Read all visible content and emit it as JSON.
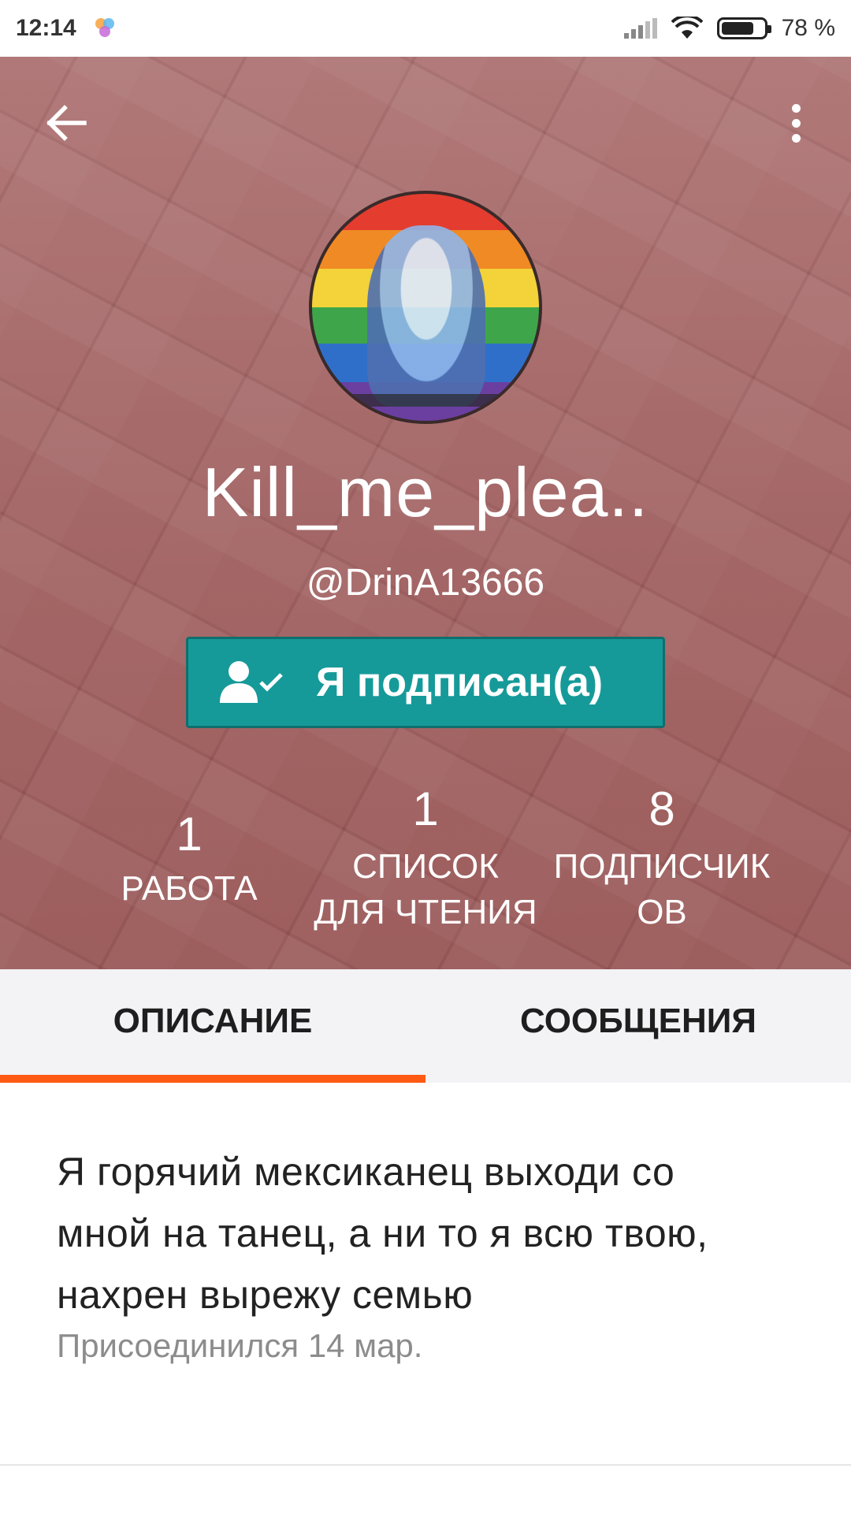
{
  "status_bar": {
    "time": "12:14",
    "battery": "78 %"
  },
  "icons": {
    "back": "arrow-left-icon",
    "more": "more-vert-icon",
    "follow": "user-check-icon",
    "signal": "signal-icon",
    "wifi": "wifi-icon",
    "battery": "battery-icon"
  },
  "profile": {
    "display_name": "Kill_me_plea..",
    "username": "@DrinA13666",
    "follow_label": "Я подписан(а)"
  },
  "stats": [
    {
      "number": "1",
      "label": "РАБОТА"
    },
    {
      "number": "1",
      "label_line1": "СПИСОК",
      "label_line2": "ДЛЯ ЧТЕНИЯ"
    },
    {
      "number": "8",
      "label_line1": "ПОДПИСЧИК",
      "label_line2": "ОВ"
    }
  ],
  "tabs": [
    {
      "label": "ОПИСАНИЕ",
      "active": true
    },
    {
      "label": "СООБЩЕНИЯ",
      "active": false
    }
  ],
  "description": {
    "lines": [
      "Я горячий мексиканец выходи со",
      "мной на танец, а ни то я всю твою,",
      "нахрен вырежу семью"
    ],
    "joined": "Присоединился 14 мар."
  },
  "colors": {
    "accent": "#ff5a14",
    "follow_button": "#169a99"
  }
}
